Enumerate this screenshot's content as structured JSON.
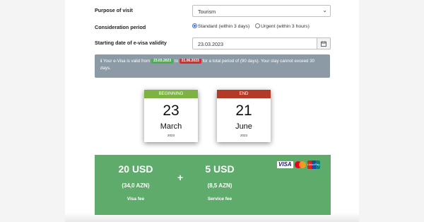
{
  "form": {
    "purpose_label": "Purpose of visit",
    "purpose_value": "Tourism",
    "period_label": "Consideration period",
    "period_options": [
      "Standard (within 3 days)",
      "Urgent (within 3 hours)"
    ],
    "period_selected": "Standard (within 3 days)",
    "start_label": "Starting date of e-visa validity",
    "start_value": "23.03.2023"
  },
  "info": {
    "prefix": "Your e-Visa is valid from",
    "from": "23.03.2023",
    "to_word": "to",
    "to": "21.06.2023",
    "suffix": "for a total period of (90 days). Your stay cannot exceed 30 days."
  },
  "calendar": {
    "begin": {
      "head": "BEGINNING",
      "day": "23",
      "month": "March",
      "year": "2023",
      "color": "#7cb342"
    },
    "end": {
      "head": "END",
      "day": "21",
      "month": "June",
      "year": "2023",
      "color": "#b23a26"
    }
  },
  "fees": {
    "visa_amount": "20 USD",
    "visa_azn": "(34,0 AZN)",
    "visa_caption": "Visa fee",
    "plus": "+",
    "service_amount": "5 USD",
    "service_azn": "(8,5 AZN)",
    "service_caption": "Service fee",
    "card_logos": [
      "visa-logo",
      "mastercard-logo",
      "unionpay-logo"
    ],
    "visa_logo_text": "VISA",
    "unionpay_text": "UnionPay",
    "bg_color": "#5fab6c"
  }
}
